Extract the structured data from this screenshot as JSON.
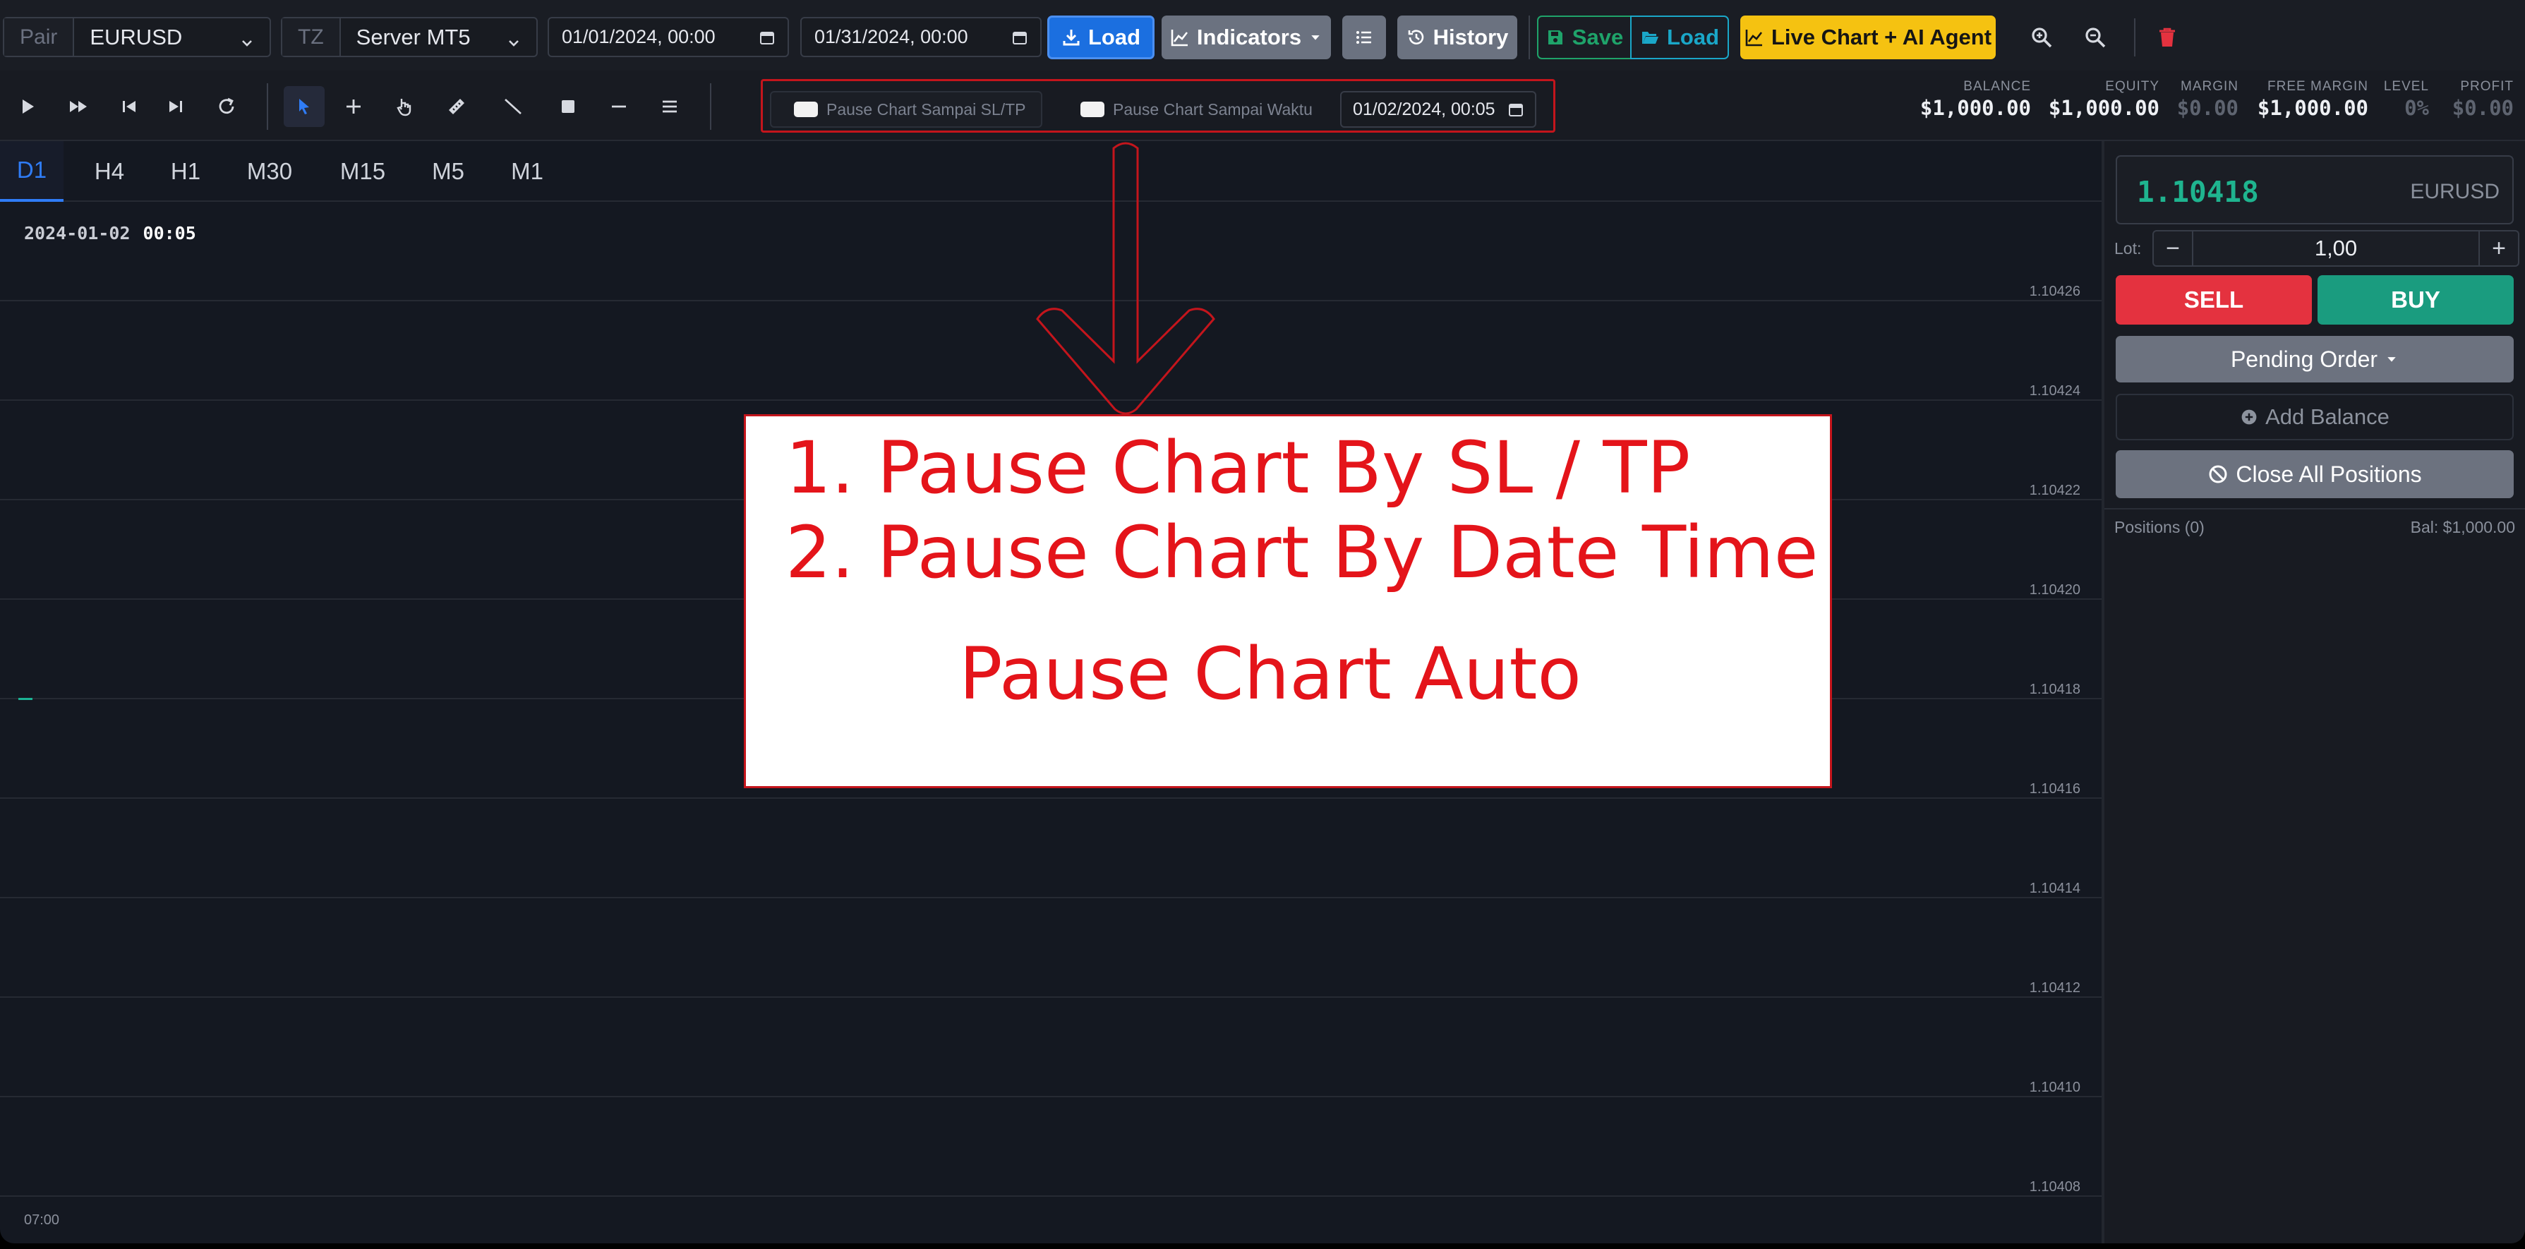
{
  "topbar": {
    "pair_label": "Pair",
    "pair_value": "EURUSD",
    "tz_label": "TZ",
    "tz_value": "Server MT5",
    "start_date": "01/01/2024, 00:00",
    "end_date": "01/31/2024, 00:00",
    "load_label": "Load",
    "indicators_label": "Indicators",
    "history_label": "History",
    "save_label": "Save",
    "load2_label": "Load",
    "live_chart_label": "Live Chart + AI Agent"
  },
  "toolbar": {
    "pause_sltp_label": "Pause Chart Sampai SL/TP",
    "pause_time_label": "Pause Chart Sampai Waktu",
    "pause_date": "01/02/2024, 00:05"
  },
  "account": [
    {
      "label": "BALANCE",
      "value": "$1,000.00",
      "dim": false
    },
    {
      "label": "EQUITY",
      "value": "$1,000.00",
      "dim": false
    },
    {
      "label": "MARGIN",
      "value": "$0.00",
      "dim": true
    },
    {
      "label": "FREE MARGIN",
      "value": "$1,000.00",
      "dim": false
    },
    {
      "label": "LEVEL",
      "value": "0%",
      "dim": true
    },
    {
      "label": "PROFIT",
      "value": "$0.00",
      "dim": true
    }
  ],
  "timeframes": [
    "D1",
    "H4",
    "H1",
    "M30",
    "M15",
    "M5",
    "M1"
  ],
  "active_timeframe": "D1",
  "chart": {
    "timestamp_date": "2024-01-02",
    "timestamp_time": "00:05",
    "price_labels": [
      "1.10426",
      "1.10424",
      "1.10422",
      "1.10420",
      "1.10418",
      "1.10416",
      "1.10414",
      "1.10412",
      "1.10410",
      "1.10408"
    ],
    "x_label": "07:00"
  },
  "annotation": {
    "line1": "1. Pause Chart By SL / TP",
    "line2": "2. Pause Chart By Date Time",
    "line3": "Pause Chart Auto",
    "color": "#e4141a"
  },
  "panel": {
    "price": "1.10418",
    "symbol": "EURUSD",
    "lot_label": "Lot:",
    "lot_value": "1,00",
    "minus": "−",
    "plus": "+",
    "sell_label": "SELL",
    "buy_label": "BUY",
    "pending_label": "Pending Order",
    "add_balance_label": "Add Balance",
    "close_all_label": "Close All Positions",
    "positions_label": "Positions (0)",
    "bal_label": "Bal: $1,000.00"
  },
  "colors": {
    "accent_blue": "#1b6fe0",
    "buy_green": "#1a9c7f",
    "sell_red": "#e4323f",
    "live_yellow": "#f5c211",
    "annotation_red": "#e4141a"
  }
}
